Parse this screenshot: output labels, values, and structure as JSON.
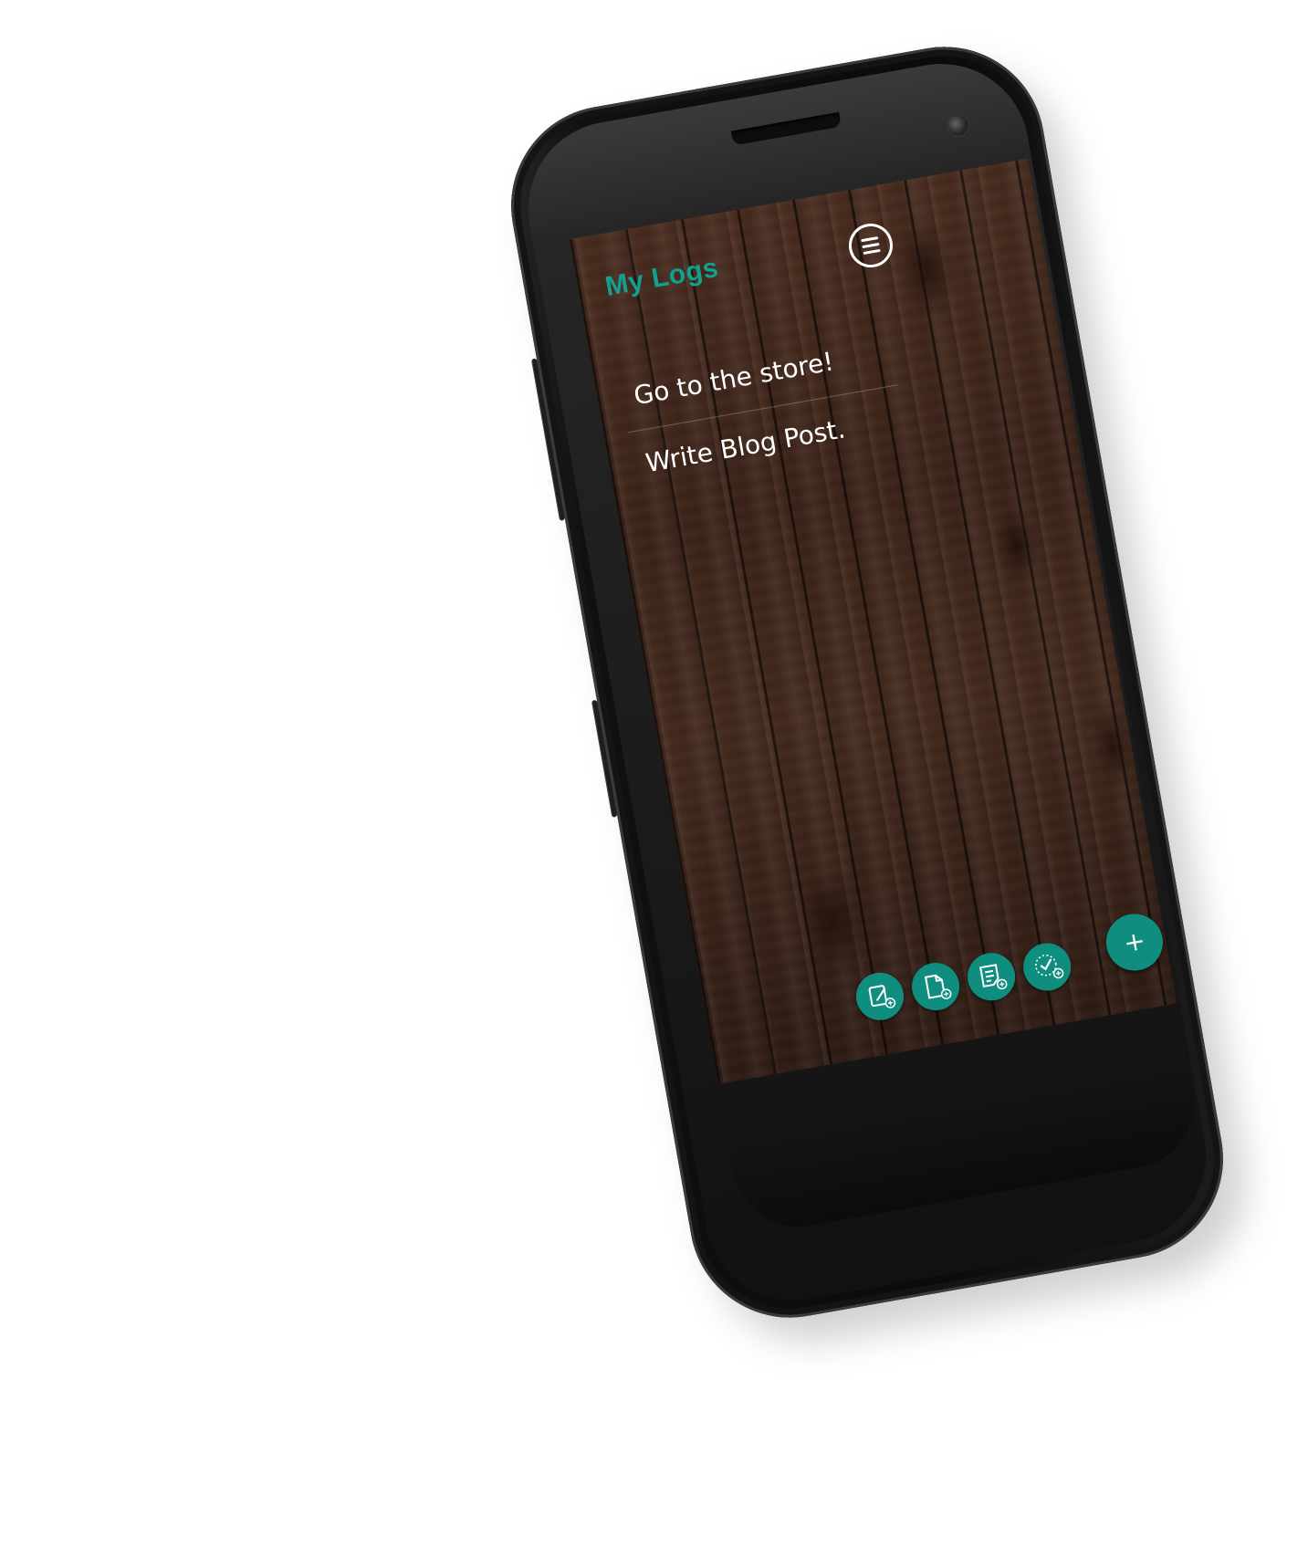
{
  "app": {
    "title": "My Logs"
  },
  "header": {
    "menu_icon": "menu-lines-icon"
  },
  "logs": [
    {
      "text": "Go to the store!"
    },
    {
      "text": "Write Blog Post."
    }
  ],
  "quick_actions": [
    {
      "icon": "new-edit-note-icon"
    },
    {
      "icon": "new-document-icon"
    },
    {
      "icon": "new-list-note-icon"
    },
    {
      "icon": "new-checklist-icon"
    }
  ],
  "fab": {
    "label": "+",
    "icon": "add-icon"
  },
  "colors": {
    "accent": "#0f8e80",
    "title": "#12a08f",
    "text": "#ffffff",
    "background_wood": "#3d2419"
  }
}
